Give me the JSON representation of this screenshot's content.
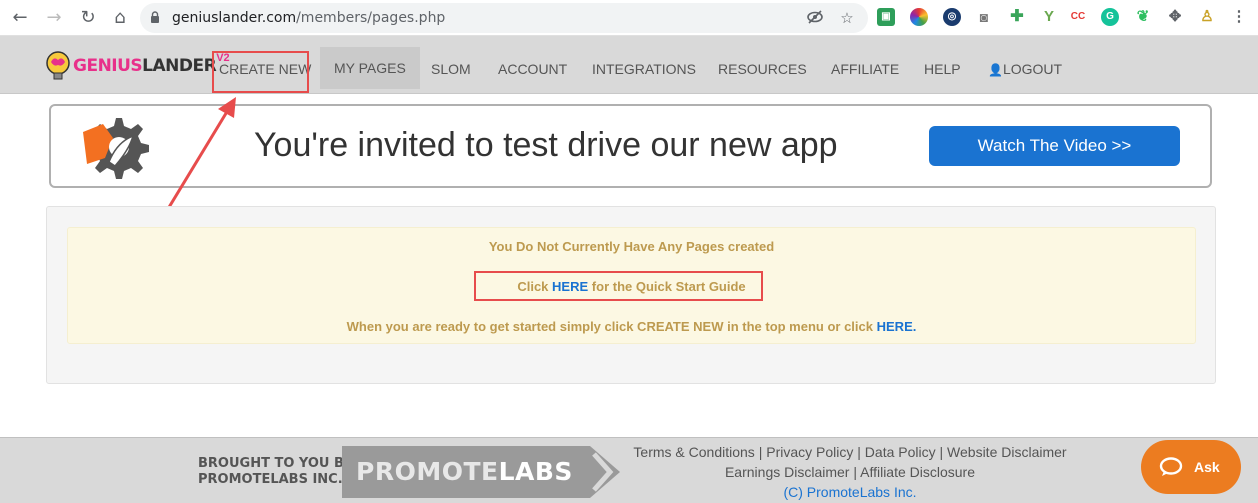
{
  "browser": {
    "url_domain": "geniuslander.com",
    "url_path": "/members/pages.php",
    "ext_cc": "CC"
  },
  "logo": {
    "part1": "GENIUS",
    "part2": "LANDER",
    "version": "V2"
  },
  "menu": {
    "create_new": "CREATE NEW",
    "my_pages": "MY PAGES",
    "slom": "SLOM",
    "account": "ACCOUNT",
    "integrations": "INTEGRATIONS",
    "resources": "RESOURCES",
    "affiliate": "AFFILIATE",
    "help": "HELP",
    "logout": "LOGOUT"
  },
  "banner": {
    "headline": "You're invited to test drive our new app",
    "button": "Watch The Video >>"
  },
  "notice": {
    "line1": "You Do Not Currently Have Any Pages created",
    "line2_prefix": "Click",
    "line2_link": "HERE",
    "line2_suffix": "for the Quick Start Guide",
    "line3_prefix": "When you are ready to get started simply click CREATE NEW in the top menu or click",
    "line3_link": "HERE."
  },
  "footer": {
    "brought_line1": "BROUGHT TO YOU BY",
    "brought_line2": "PROMOTELABS INC.",
    "logo_part1": "PROMOTE",
    "logo_part2": "LABS",
    "links": {
      "terms": "Terms & Conditions",
      "privacy": "Privacy Policy",
      "data": "Data Policy",
      "website": "Website Disclaimer",
      "earnings": "Earnings Disclaimer",
      "affiliate": "Affiliate Disclosure",
      "copyright": "(C) PromoteLabs Inc.",
      "sep": "|"
    }
  },
  "chat": {
    "label": "Ask"
  },
  "colors": {
    "accent_blue": "#1a73d1",
    "annotation_red": "#e74c4c",
    "notice_text": "#bd9a4f",
    "chat_orange": "#ec7c20"
  }
}
